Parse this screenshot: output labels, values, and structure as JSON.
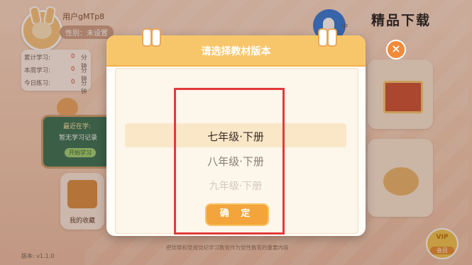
{
  "user": {
    "name": "用户gMTp8",
    "gender_label": "性别：未设置"
  },
  "stats": {
    "rows": [
      {
        "label": "累计学习:",
        "value": "0",
        "unit": "分钟"
      },
      {
        "label": "本周学习:",
        "value": "0",
        "unit": "分钟"
      },
      {
        "label": "今日练习:",
        "value": "0",
        "unit": "分钟"
      }
    ]
  },
  "recent": {
    "title": "最近在学:",
    "empty": "暂无学习记录",
    "button": "开始学习"
  },
  "favorites": {
    "label": "我的收藏"
  },
  "watermark": {
    "brand": "精品下载",
    "mid": "中"
  },
  "dialog": {
    "title": "请选择教材版本",
    "options": [
      "七年级·下册",
      "八年级·下册",
      "九年级·下册"
    ],
    "selected_index": 0,
    "confirm": "确 定",
    "close_icon": "×"
  },
  "footer": {
    "version": "版本: v1.1.0",
    "note": "把党章和党规党纪学习教育作为党性教育的重要内容"
  },
  "vip": {
    "badge": "VIP",
    "label": "会员"
  },
  "colors": {
    "dialog_header": "#f8c66a",
    "confirm_button": "#f3a43b",
    "highlight_box": "#e23a3a",
    "selected_row": "#f9e7c8"
  }
}
